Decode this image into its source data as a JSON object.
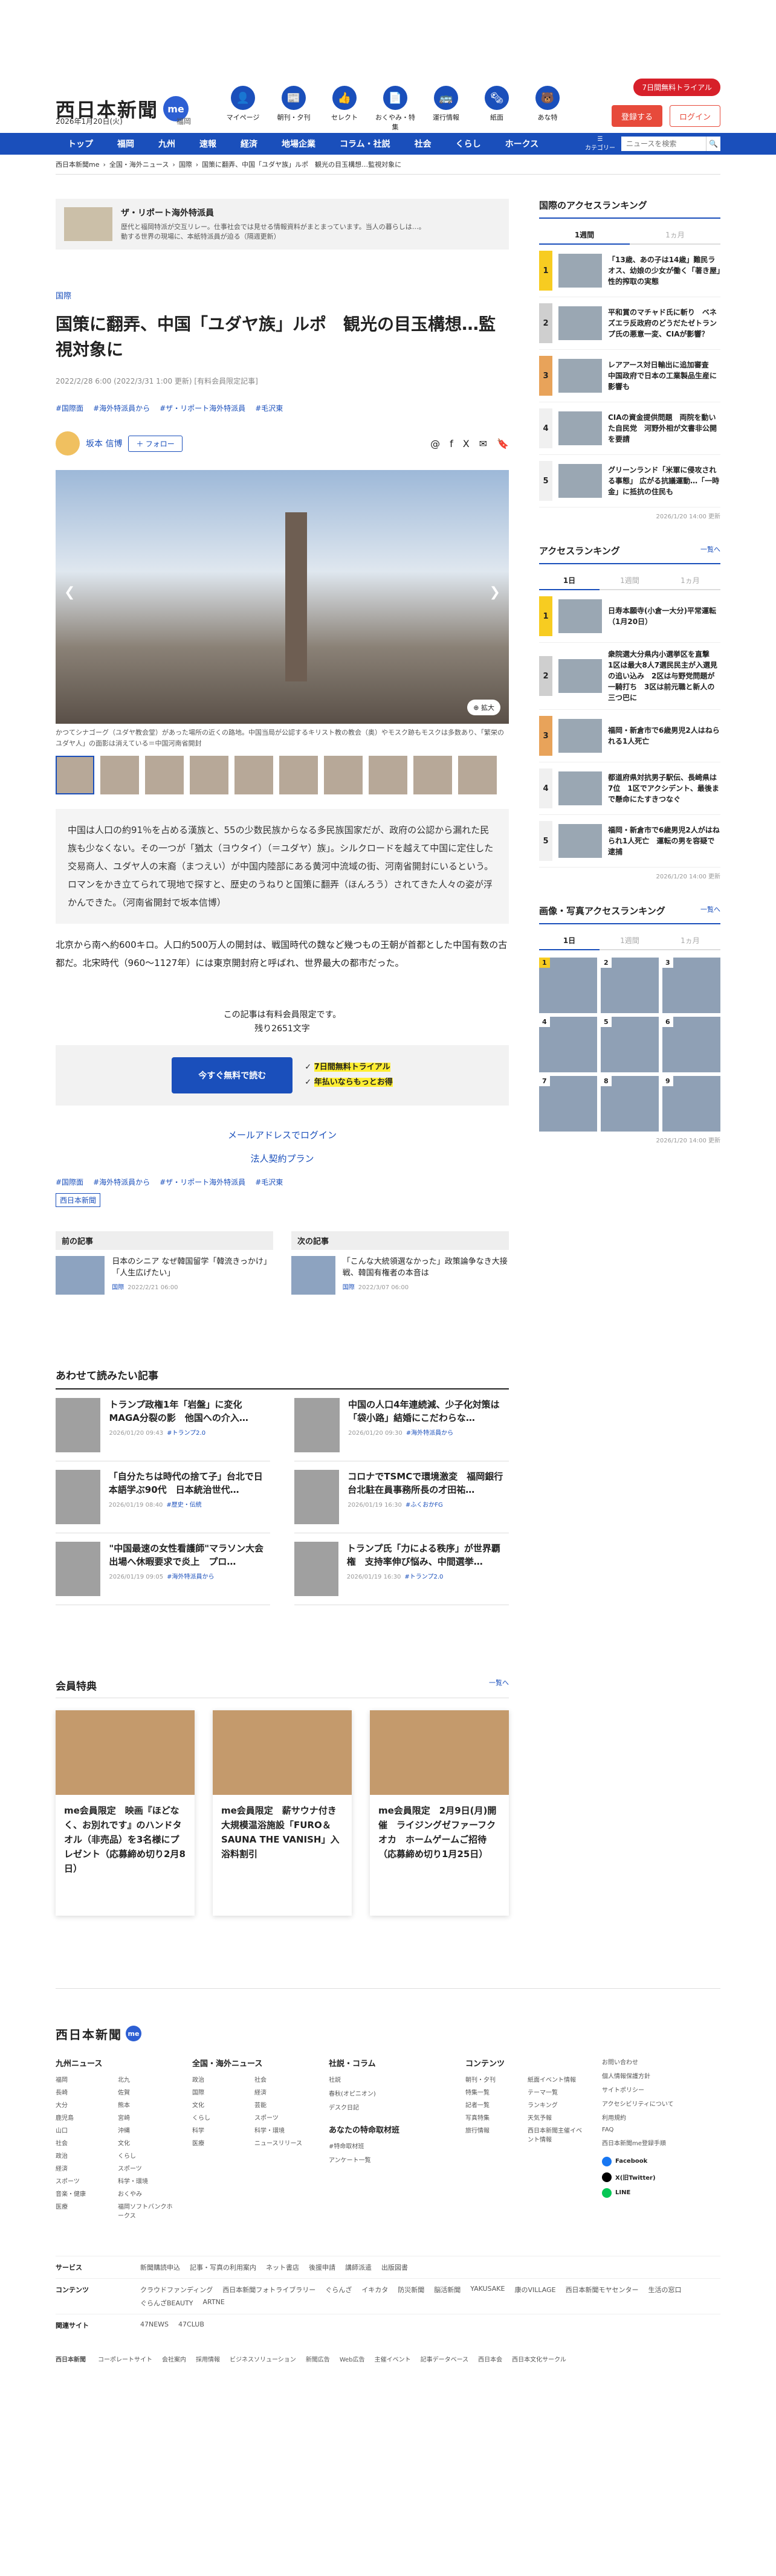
{
  "header": {
    "logo_text": "西日本新聞",
    "logo_me": "me",
    "date": "2026年1月20日(火)",
    "location": "福岡",
    "icons": [
      {
        "label": "マイページ",
        "glyph": "👤"
      },
      {
        "label": "朝刊・夕刊",
        "glyph": "📰"
      },
      {
        "label": "セレクト",
        "glyph": "👍"
      },
      {
        "label": "おくやみ・特集",
        "glyph": "📄"
      },
      {
        "label": "運行情報",
        "glyph": "🚌"
      },
      {
        "label": "紙面",
        "glyph": "🗞"
      },
      {
        "label": "あな特",
        "glyph": "🐻"
      }
    ],
    "trial": "7日間無料トライアル",
    "register": "登録する",
    "login": "ログイン"
  },
  "nav": {
    "items": [
      "トップ",
      "福岡",
      "九州",
      "速報",
      "経済",
      "地場企業",
      "コラム・社説",
      "社会",
      "くらし",
      "ホークス"
    ],
    "category": "カテゴリー",
    "search_placeholder": "ニュースを検索"
  },
  "breadcrumb": [
    "西日本新聞me",
    "全国・海外ニュース",
    "国際",
    "国策に翻弄、中国「ユダヤ族」ルポ　観光の目玉構想…監視対象に"
  ],
  "banner": {
    "title": "ザ・リポート海外特派員",
    "desc": "歴代と福岡特派が交互リレー。仕事社会では見せる情報資料がまとまっています。当人の暮らしは…。",
    "desc2": "動する世界の現場に、本紙特派員が迫る（隔週更新）"
  },
  "article": {
    "category": "国際",
    "title": "国策に翻弄、中国「ユダヤ族」ルポ　観光の目玉構想…監視対象に",
    "meta": "2022/2/28 6:00 (2022/3/31 1:00 更新) [有料会員限定記事]",
    "tags": [
      "#国際面",
      "#海外特派員から",
      "#ザ・リポート海外特派員",
      "#毛沢東"
    ],
    "author": "坂本 信博",
    "follow": "＋ フォロー",
    "share": [
      "@",
      "f",
      "X",
      "✉",
      "🔖"
    ],
    "expand": "拡大",
    "caption": "かつてシナゴーグ（ユダヤ教会堂）があった場所の近くの路地。中国当局が公認するキリスト教の教会（奥）やモスク跡もモスクは多数あり、「繁栄のユダヤ人」の面影は消えている＝中国河南省開封",
    "lead": "中国は人口の約91％を占める漢族と、55の少数民族からなる多民族国家だが、政府の公認から漏れた民族も少なくない。その一つが「猶太（ヨウタイ）（＝ユダヤ）族」。シルクロードを越えて中国に定住した交易商人、ユダヤ人の末裔（まつえい）が中国内陸部にある黄河中流域の街、河南省開封にいるという。ロマンをかき立てられて現地で探すと、歴史のうねりと国策に翻弄（ほんろう）されてきた人々の姿が浮かんできた。（河南省開封で坂本信博）",
    "body": "北京から南へ約600キロ。人口約500万人の開封は、戦国時代の魏など幾つもの王朝が首都とした中国有数の古都だ。北宋時代（960～1127年）には東京開封府と呼ばれ、世界最大の都市だった。",
    "paid_1": "この記事は有料会員限定です。",
    "paid_2": "残り2651文字",
    "free_btn": "今すぐ無料で読む",
    "hl1": "7日間無料トライアル",
    "hl2": "年払いならもっとお得",
    "mail_login": "メールアドレスでログイン",
    "corp": "法人契約プラン",
    "source": "西日本新聞"
  },
  "prevnext": [
    {
      "head": "前の記事",
      "title": "日本のシニア なぜ韓国留学「韓流きっかけ」「人生広げたい」",
      "tag": "国際",
      "date": "2022/2/21 06:00"
    },
    {
      "head": "次の記事",
      "title": "「こんな大統領選なかった」政策論争なき大接戦、韓国有権者の本音は",
      "tag": "国際",
      "date": "2022/3/07 06:00"
    }
  ],
  "side": {
    "access_title": "国際のアクセスランキング",
    "access_tabs": [
      "1週間",
      "1ヵ月"
    ],
    "access": [
      {
        "n": "1",
        "t": "「13歳、あの子は14歳」難民ラオス、幼娘の少女が働く「著き屋」性的搾取の実態"
      },
      {
        "n": "2",
        "t": "平和賞のマチャド氏に斬り　ベネズエラ反政府のどうだたゼトランプ氏の悪意一変、CIAが影響？"
      },
      {
        "n": "3",
        "t": "レアアース対日輸出に追加審査　中国政府で日本の工業製品生産に影響も"
      },
      {
        "n": "4",
        "t": "CIAの資金提供問題　両院を動いた自民党　河野外相が文書非公開を要請"
      },
      {
        "n": "5",
        "t": "グリーンランド「米軍に侵攻される事態」 広がる抗議運動…「一時金」に抵抗の住民も"
      }
    ],
    "access_upd": "2026/1/20 14:00 更新",
    "all_title": "アクセスランキング",
    "all_more": "一覧へ",
    "all_tabs": [
      "1日",
      "1週間",
      "1ヵ月"
    ],
    "all": [
      {
        "n": "1",
        "t": "日寿本願寺(小倉一大分)平常運転（1月20日）"
      },
      {
        "n": "2",
        "t": "衆院選大分県内小選挙区を直撃　1区は最大8人7選民民主が入選見の追い込み　2区は与野党問題が一騎打ち　3区は前元職と新人の三つ巴に"
      },
      {
        "n": "3",
        "t": "福岡・新倉市で6歳男児2人はねられる1人死亡"
      },
      {
        "n": "4",
        "t": "都道府県対抗男子駅伝、長崎県は7位　1区でアクシデント、最後まで懸命にたすきつなぐ"
      },
      {
        "n": "5",
        "t": "福岡・新倉市で6歳男児2人がはねられ1人死亡　運転の男を容疑で逮捕"
      }
    ],
    "all_upd": "2026/1/20 14:00 更新",
    "photo_title": "画像・写真アクセスランキング",
    "photo_more": "一覧へ",
    "photo_tabs": [
      "1日",
      "1週間",
      "1ヵ月"
    ],
    "photo_nums": [
      "1",
      "2",
      "3",
      "4",
      "5",
      "6",
      "7",
      "8",
      "9"
    ],
    "photo_upd": "2026/1/20 14:00 更新"
  },
  "recommend": {
    "title": "あわせて読みたい記事",
    "items": [
      {
        "t": "トランプ政権1年「岩盤」に変化　MAGA分裂の影　他国への介入…",
        "d": "2026/01/20 09:43",
        "tag": "#トランプ2.0"
      },
      {
        "t": "中国の人口4年連続減、少子化対策は「袋小路」結婚にこだわらな…",
        "d": "2026/01/20 09:30",
        "tag": "#海外特派員から"
      },
      {
        "t": "「自分たちは時代の捨て子」台北で日本語学ぶ90代　日本統治世代…",
        "d": "2026/01/19 08:40",
        "tag": "#歴史・伝統"
      },
      {
        "t": "コロナでTSMCで環境激変　福岡銀行台北駐在員事務所長の才田祐…",
        "d": "2026/01/19 16:30",
        "tag": "#ふくおかFG"
      },
      {
        "t": "\"中国最速の女性看護師\"マラソン大会出場へ休暇要求で炎上　プロ…",
        "d": "2026/01/19 09:05",
        "tag": "#海外特派員から"
      },
      {
        "t": "トランプ氏「力による秩序」が世界覇権　支持率伸び悩み、中間選挙…",
        "d": "2026/01/19 16:30",
        "tag": "#トランプ2.0"
      }
    ]
  },
  "benefits": {
    "title": "会員特典",
    "more": "一覧へ",
    "items": [
      "me会員限定　映画『ほどなく、お別れです』のハンドタオル（非売品）を3名様にプレゼント（応募締め切り2月8日）",
      "me会員限定　薪サウナ付き大規模温浴施設「FURO＆SAUNA THE VANISH」入浴料割引",
      "me会員限定　2月9日(月)開催　ライジングゼファーフクオカ　ホームゲームご招待（応募締め切り1月25日）"
    ]
  },
  "footer": {
    "cols": [
      {
        "h": "九州ニュース",
        "items": [
          "福岡",
          "北九",
          "長崎",
          "佐賀",
          "大分",
          "熊本",
          "鹿児島",
          "宮崎",
          "山口",
          "沖縄",
          "社会",
          "文化",
          "政治",
          "くらし",
          "経済",
          "スポーツ",
          "スポーツ",
          "科学・環境",
          "音楽・健康",
          "おくやみ",
          "医療",
          "福岡ソフトバンクホークス"
        ]
      },
      {
        "h": "全国・海外ニュース",
        "items": [
          "政治",
          "社会",
          "国際",
          "経済",
          "文化",
          "芸能",
          "くらし",
          "スポーツ",
          "科学",
          "科学・環境",
          "医療",
          "ニュースリリース"
        ]
      },
      {
        "h": "社説・コラム",
        "items": [
          "社説",
          "春秋(オピニオン)",
          "デスク日記"
        ],
        "h2": "あなたの特命取材班",
        "items2": [
          "#特命取材班",
          "アンケート一覧"
        ]
      },
      {
        "h": "コンテンツ",
        "items": [
          "朝刊・夕刊",
          "紙面イベント情報",
          "特集一覧",
          "テーマ一覧",
          "記者一覧",
          "ランキング",
          "写真特集",
          "天気予報",
          "旅行情報",
          "西日本新聞主催イベント情報"
        ]
      }
    ],
    "side_links": [
      "お問い合わせ",
      "個人情報保護方針",
      "サイトポリシー",
      "アクセシビリティについて",
      "利用規約",
      "FAQ",
      "西日本新聞me登録手順"
    ],
    "social": [
      "Facebook",
      "X(旧Twitter)",
      "LINE"
    ],
    "rows": [
      {
        "h": "サービス",
        "items": [
          "新聞購読申込",
          "記事・写真の利用案内",
          "ネット書店",
          "後援申請",
          "講師派遣",
          "出版図書"
        ]
      },
      {
        "h": "コンテンツ",
        "items": [
          "クラウドファンディング",
          "西日本新聞フォトライブラリー",
          "ぐらんざ",
          "イキカタ",
          "防災新聞",
          "脳活新聞",
          "YAKUSAKE",
          "康のVILLAGE",
          "西日本新聞モヤセンター",
          "生活の窓口",
          "ぐらんざBEAUTY",
          "ARTNE"
        ]
      },
      {
        "h": "関連サイト",
        "items": [
          "47NEWS",
          "47CLUB"
        ]
      }
    ],
    "bottom_logo": "西日本新聞",
    "bottom": [
      "コーポレートサイト",
      "会社案内",
      "採用情報",
      "ビジネスソリューション",
      "新聞広告",
      "Web広告",
      "主催イベント",
      "記事データベース",
      "西日本会",
      "西日本文化サークル"
    ]
  }
}
